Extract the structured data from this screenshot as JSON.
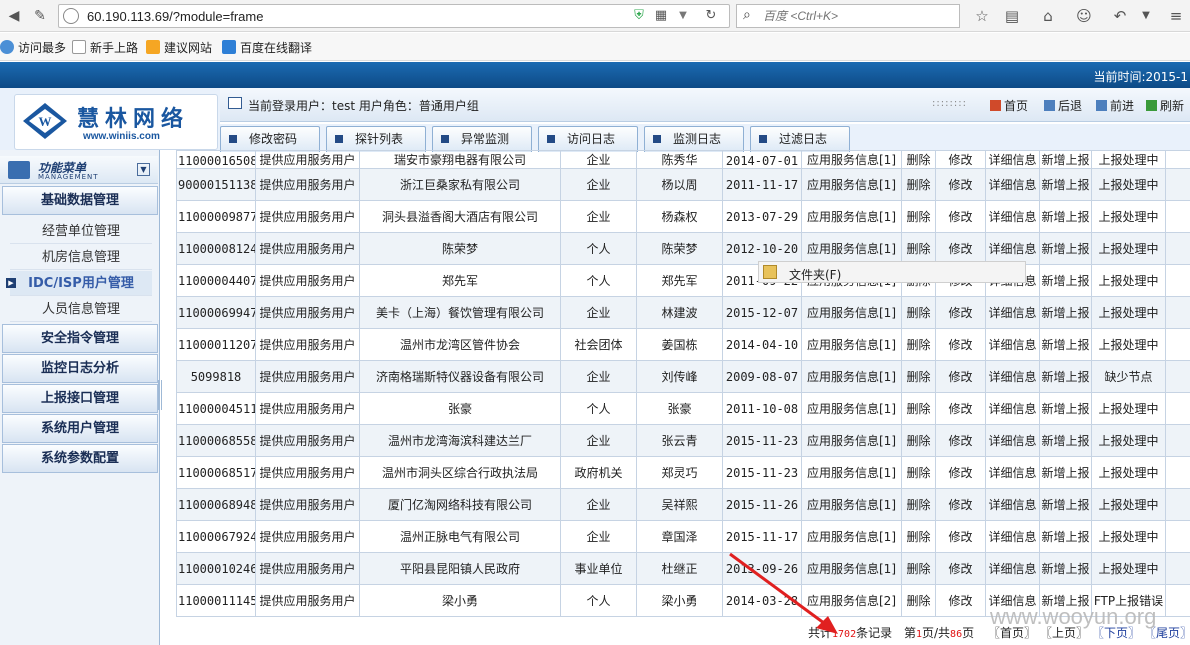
{
  "browser": {
    "url": "60.190.113.69/?module=frame",
    "search_placeholder": "百度 <Ctrl+K>",
    "bookmarks": [
      "访问最多",
      "新手上路",
      "建议网站",
      "百度在线翻译"
    ]
  },
  "header": {
    "time_label": "当前时间:2015-1",
    "logo_title": "慧林网络",
    "logo_url": "www.winiis.com",
    "user_info": "当前登录用户：test 用户角色：普通用户组",
    "top_links": [
      "首页",
      "后退",
      "前进",
      "刷新"
    ]
  },
  "tabs": [
    "修改密码",
    "探针列表",
    "异常监测",
    "访问日志",
    "监测日志",
    "过滤日志"
  ],
  "sidebar": {
    "menu_title": "功能菜单",
    "menu_subtitle": "MANAGEMENT",
    "groups": {
      "basic": "基础数据管理",
      "security": "安全指令管理",
      "monitor": "监控日志分析",
      "upload": "上报接口管理",
      "sysuser": "系统用户管理",
      "sysparam": "系统参数配置"
    },
    "items": [
      "经营单位管理",
      "机房信息管理",
      "IDC/ISP用户管理",
      "人员信息管理"
    ]
  },
  "table": {
    "rows": [
      {
        "id": "110000165080",
        "type": "提供应用服务用户",
        "name": "瑞安市豪翔电器有限公司",
        "cat": "企业",
        "contact": "陈秀华",
        "date": "2014-07-01",
        "info": "应用服务信息[1]",
        "del": "删除",
        "edit": "修改",
        "detail": "详细信息",
        "report": "新增上报",
        "status": "上报处理中"
      },
      {
        "id": "90000151138",
        "type": "提供应用服务用户",
        "name": "浙江巨桑家私有限公司",
        "cat": "企业",
        "contact": "杨以周",
        "date": "2011-11-17",
        "info": "应用服务信息[1]",
        "del": "删除",
        "edit": "修改",
        "detail": "详细信息",
        "report": "新增上报",
        "status": "上报处理中"
      },
      {
        "id": "110000098770",
        "type": "提供应用服务用户",
        "name": "洞头县溢香阁大酒店有限公司",
        "cat": "企业",
        "contact": "杨森权",
        "date": "2013-07-29",
        "info": "应用服务信息[1]",
        "del": "删除",
        "edit": "修改",
        "detail": "详细信息",
        "report": "新增上报",
        "status": "上报处理中"
      },
      {
        "id": "110000081247",
        "type": "提供应用服务用户",
        "name": "陈荣梦",
        "cat": "个人",
        "contact": "陈荣梦",
        "date": "2012-10-20",
        "info": "应用服务信息[1]",
        "del": "删除",
        "edit": "修改",
        "detail": "详细信息",
        "report": "新增上报",
        "status": "上报处理中"
      },
      {
        "id": "110000044071",
        "type": "提供应用服务用户",
        "name": "郑先军",
        "cat": "个人",
        "contact": "郑先军",
        "date": "2011-09-22",
        "info": "应用服务信息[1]",
        "del": "删除",
        "edit": "修改",
        "detail": "详细信息",
        "report": "新增上报",
        "status": "上报处理中"
      },
      {
        "id": "110000699476",
        "type": "提供应用服务用户",
        "name": "美卡（上海）餐饮管理有限公司",
        "cat": "企业",
        "contact": "林建波",
        "date": "2015-12-07",
        "info": "应用服务信息[1]",
        "del": "删除",
        "edit": "修改",
        "detail": "详细信息",
        "report": "新增上报",
        "status": "上报处理中"
      },
      {
        "id": "110000112071",
        "type": "提供应用服务用户",
        "name": "温州市龙湾区管件协会",
        "cat": "社会团体",
        "contact": "姜国栋",
        "date": "2014-04-10",
        "info": "应用服务信息[1]",
        "del": "删除",
        "edit": "修改",
        "detail": "详细信息",
        "report": "新增上报",
        "status": "上报处理中"
      },
      {
        "id": "5099818",
        "type": "提供应用服务用户",
        "name": "济南格瑞斯特仪器设备有限公司",
        "cat": "企业",
        "contact": "刘传峰",
        "date": "2009-08-07",
        "info": "应用服务信息[1]",
        "del": "删除",
        "edit": "修改",
        "detail": "详细信息",
        "report": "新增上报",
        "status": "缺少节点"
      },
      {
        "id": "110000045116",
        "type": "提供应用服务用户",
        "name": "张豪",
        "cat": "个人",
        "contact": "张豪",
        "date": "2011-10-08",
        "info": "应用服务信息[1]",
        "del": "删除",
        "edit": "修改",
        "detail": "详细信息",
        "report": "新增上报",
        "status": "上报处理中"
      },
      {
        "id": "110000685586",
        "type": "提供应用服务用户",
        "name": "温州市龙湾海滨科建达兰厂",
        "cat": "企业",
        "contact": "张云青",
        "date": "2015-11-23",
        "info": "应用服务信息[1]",
        "del": "删除",
        "edit": "修改",
        "detail": "详细信息",
        "report": "新增上报",
        "status": "上报处理中"
      },
      {
        "id": "110000685179",
        "type": "提供应用服务用户",
        "name": "温州市洞头区综合行政执法局",
        "cat": "政府机关",
        "contact": "郑灵巧",
        "date": "2015-11-23",
        "info": "应用服务信息[1]",
        "del": "删除",
        "edit": "修改",
        "detail": "详细信息",
        "report": "新增上报",
        "status": "上报处理中"
      },
      {
        "id": "110000689487",
        "type": "提供应用服务用户",
        "name": "厦门亿淘网络科技有限公司",
        "cat": "企业",
        "contact": "吴祥熙",
        "date": "2015-11-26",
        "info": "应用服务信息[1]",
        "del": "删除",
        "edit": "修改",
        "detail": "详细信息",
        "report": "新增上报",
        "status": "上报处理中"
      },
      {
        "id": "110000679246",
        "type": "提供应用服务用户",
        "name": "温州正脉电气有限公司",
        "cat": "企业",
        "contact": "章国泽",
        "date": "2015-11-17",
        "info": "应用服务信息[1]",
        "del": "删除",
        "edit": "修改",
        "detail": "详细信息",
        "report": "新增上报",
        "status": "上报处理中"
      },
      {
        "id": "110000102465",
        "type": "提供应用服务用户",
        "name": "平阳县昆阳镇人民政府",
        "cat": "事业单位",
        "contact": "杜继正",
        "date": "2013-09-26",
        "info": "应用服务信息[1]",
        "del": "删除",
        "edit": "修改",
        "detail": "详细信息",
        "report": "新增上报",
        "status": "上报处理中"
      },
      {
        "id": "110000111453",
        "type": "提供应用服务用户",
        "name": "梁小勇",
        "cat": "个人",
        "contact": "梁小勇",
        "date": "2014-03-28",
        "info": "应用服务信息[2]",
        "del": "删除",
        "edit": "修改",
        "detail": "详细信息",
        "report": "新增上报",
        "status": "FTP上报错误"
      }
    ]
  },
  "popup": {
    "label": "文件夹(F)"
  },
  "pager": {
    "total_prefix": "共计",
    "total": "1702",
    "total_suffix": "条记录",
    "page_prefix": "第",
    "page": "1",
    "page_mid": "页/共",
    "pages": "86",
    "page_suffix": "页",
    "first": "〖首页〗",
    "prev": "〖上页〗",
    "next": "〖下页〗",
    "last": "〖尾页〗"
  },
  "watermark": "www.wooyun.org",
  "colors": {
    "brand_blue": "#0d4a86",
    "link_blue": "#1f3f9e",
    "status_red": "#e01010"
  }
}
